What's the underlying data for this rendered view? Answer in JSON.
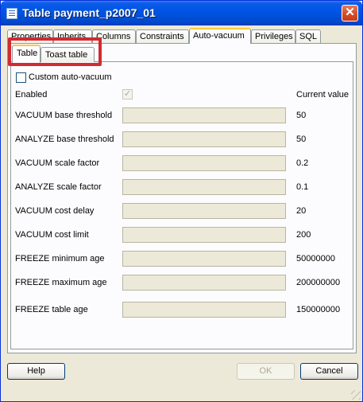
{
  "window": {
    "title": "Table payment_p2007_01",
    "close_symbol": "✕"
  },
  "tabs": [
    {
      "label": "Properties",
      "active": false
    },
    {
      "label": "Inherits",
      "active": false
    },
    {
      "label": "Columns",
      "active": false
    },
    {
      "label": "Constraints",
      "active": false
    },
    {
      "label": "Auto-vacuum",
      "active": true
    },
    {
      "label": "Privileges",
      "active": false
    },
    {
      "label": "SQL",
      "active": false
    }
  ],
  "subtabs": [
    {
      "label": "Table",
      "active": true
    },
    {
      "label": "Toast table",
      "active": false
    }
  ],
  "custom_autovacuum": {
    "label": "Custom auto-vacuum",
    "checked": false
  },
  "enabled": {
    "label": "Enabled",
    "checked": true,
    "check_symbol": "✓"
  },
  "current_value_header": "Current value",
  "settings": [
    {
      "label": "VACUUM base threshold",
      "value": "",
      "current": "50"
    },
    {
      "label": "ANALYZE base threshold",
      "value": "",
      "current": "50"
    },
    {
      "label": "VACUUM scale factor",
      "value": "",
      "current": "0.2"
    },
    {
      "label": "ANALYZE scale factor",
      "value": "",
      "current": "0.1"
    },
    {
      "label": "VACUUM cost delay",
      "value": "",
      "current": "20"
    },
    {
      "label": "VACUUM cost limit",
      "value": "",
      "current": "200"
    },
    {
      "label": "FREEZE minimum age",
      "value": "",
      "current": "50000000"
    },
    {
      "label": "FREEZE maximum age",
      "value": "",
      "current": "200000000"
    },
    {
      "label": "FREEZE table age",
      "value": "",
      "current": "150000000"
    }
  ],
  "buttons": {
    "help": "Help",
    "ok": "OK",
    "cancel": "Cancel"
  },
  "colors": {
    "titlebar": "#0054e3",
    "dialog_bg": "#ece9d8",
    "highlight": "#d22a30",
    "tab_hot": "#ffc83c"
  }
}
